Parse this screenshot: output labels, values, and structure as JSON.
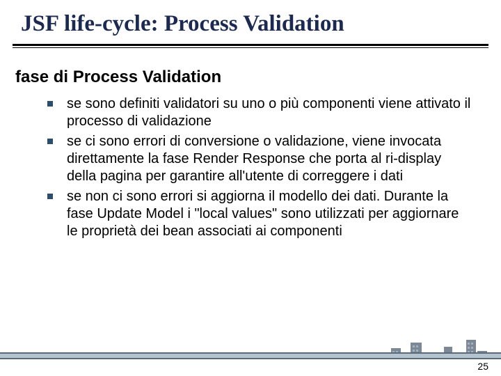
{
  "title": "JSF life-cycle: Process Validation",
  "section_heading": "fase di Process Validation",
  "bullets": [
    "se sono definiti validatori su uno o più componenti viene attivato il processo di validazione",
    "se ci sono errori di conversione o validazione, viene invocata direttamente la fase Render Response che porta al ri-display della pagina per garantire all'utente di correggere i dati",
    "se non ci sono errori si aggiorna il modello dei dati. Durante la fase Update Model i \"local values\" sono utilizzati per aggiornare le proprietà dei bean associati ai componenti"
  ],
  "page_number": "25"
}
